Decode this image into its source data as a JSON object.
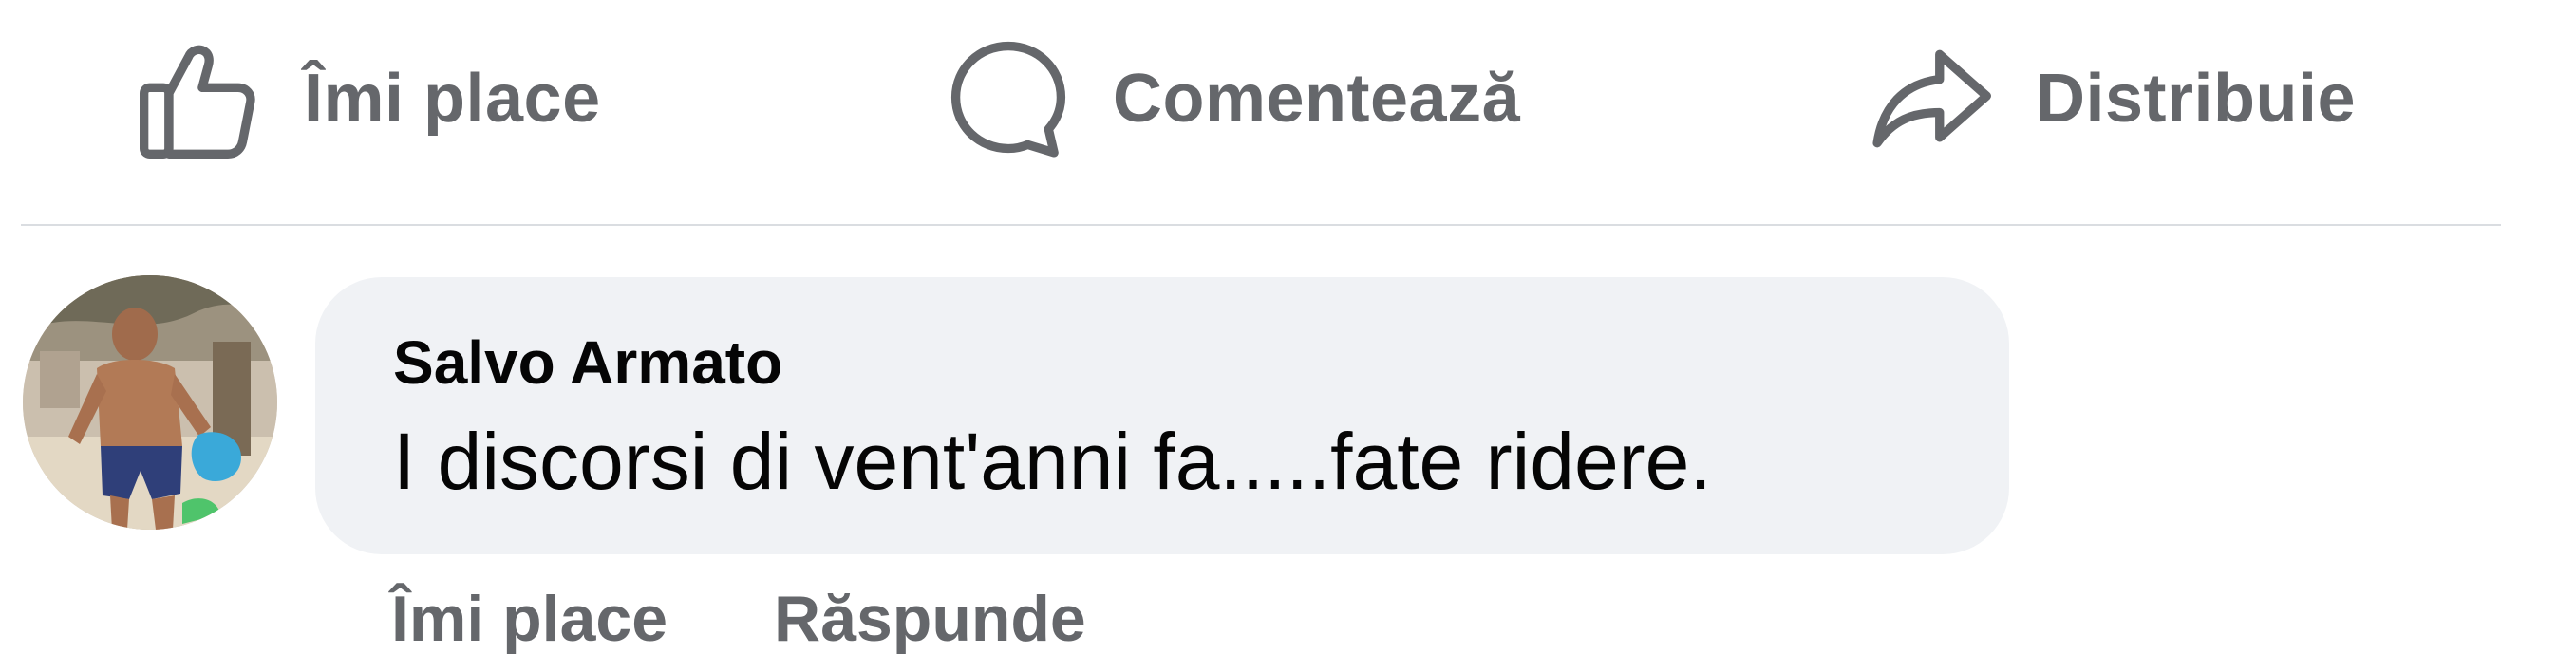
{
  "actions": {
    "like": {
      "label": "Îmi place",
      "icon": "thumbs-up-icon"
    },
    "comment": {
      "label": "Comentează",
      "icon": "comment-bubble-icon"
    },
    "share": {
      "label": "Distribuie",
      "icon": "share-arrow-icon"
    }
  },
  "comment": {
    "author": "Salvo Armato",
    "text": "I discorsi di vent'anni fa.....fate ridere.",
    "actions": {
      "like_label": "Îmi place",
      "reply_label": "Răspunde"
    }
  },
  "colors": {
    "icon_text": "#65676b",
    "bubble_bg": "#f0f2f5",
    "divider": "#dadde1",
    "primary_text": "#050505"
  }
}
